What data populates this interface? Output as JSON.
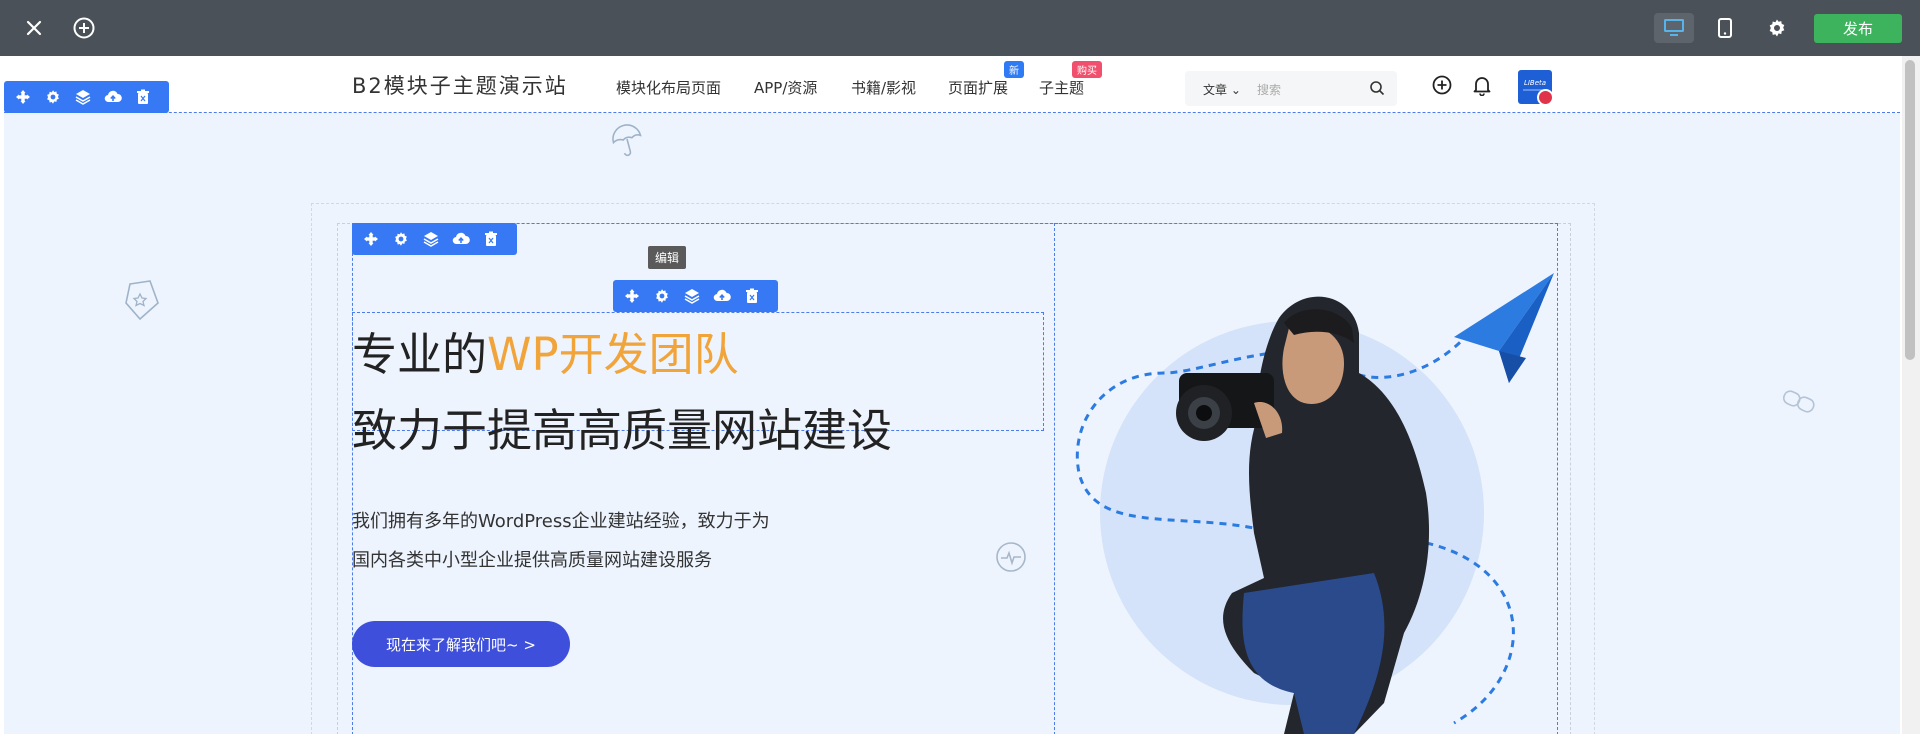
{
  "topbar": {
    "close_icon": "close-icon",
    "add_icon": "add-circle-icon",
    "desktop_icon": "desktop-icon",
    "mobile_icon": "mobile-icon",
    "settings_icon": "gear-icon",
    "publish_label": "发布",
    "publish_color": "#3cb35c"
  },
  "site": {
    "title": "B2模块子主题演示站",
    "nav": [
      {
        "label": "模块化布局页面"
      },
      {
        "label": "APP/资源"
      },
      {
        "label": "书籍/影视"
      },
      {
        "label": "页面扩展",
        "badge": "新",
        "badge_color": "#2f7bf5"
      },
      {
        "label": "子主题",
        "badge": "购买",
        "badge_color": "#f0506e"
      }
    ],
    "search": {
      "category": "文章",
      "placeholder": "搜索"
    },
    "avatar_text": "LIBeta"
  },
  "editor": {
    "toolbar_icons": [
      "move-icon",
      "gear-icon",
      "layers-icon",
      "cloud-upload-icon",
      "trash-icon"
    ],
    "tooltip": "编辑",
    "accent": "#3779f4"
  },
  "hero": {
    "heading_line1_prefix": "专业的",
    "heading_line1_accent": "WP开发团队",
    "heading_line2": "致力于提高高质量网站建设",
    "description_line1": "我们拥有多年的WordPress企业建站经验，致力于为",
    "description_line2": "国内各类中小型企业提供高质量网站建设服务",
    "cta_label": "现在来了解我们吧~ >",
    "accent_color": "#f0a43a",
    "cta_color": "#3d4fdb"
  }
}
